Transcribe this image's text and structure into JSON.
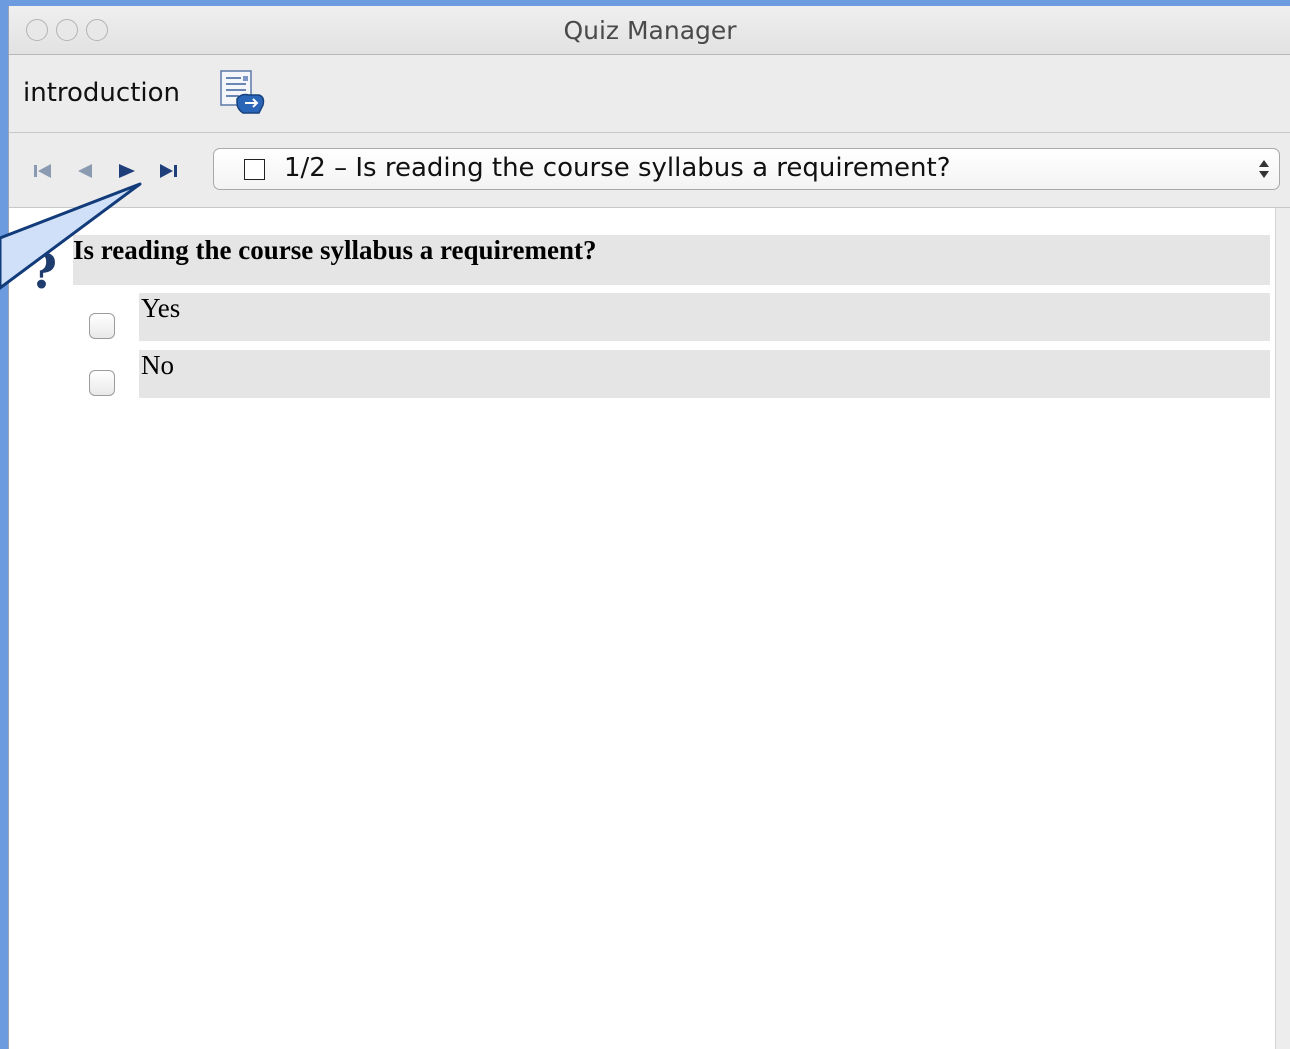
{
  "window": {
    "title": "Quiz Manager"
  },
  "toolbar": {
    "section_label": "introduction",
    "section_icon": "document-edit-icon"
  },
  "navigation": {
    "buttons": [
      "first-icon",
      "previous-icon",
      "next-icon",
      "last-icon"
    ],
    "question_select_value": "1/2 – Is reading the course syllabus a requirement?"
  },
  "question": {
    "icon": "question-mark-icon",
    "text": "Is reading the course syllabus a requirement?",
    "answers": [
      {
        "label": "Yes"
      },
      {
        "label": "No"
      }
    ]
  },
  "colors": {
    "background": "#6c9be0",
    "callout_fill": "#cfe0f8",
    "callout_stroke": "#123b7a",
    "question_row": "#e5e5e5"
  }
}
